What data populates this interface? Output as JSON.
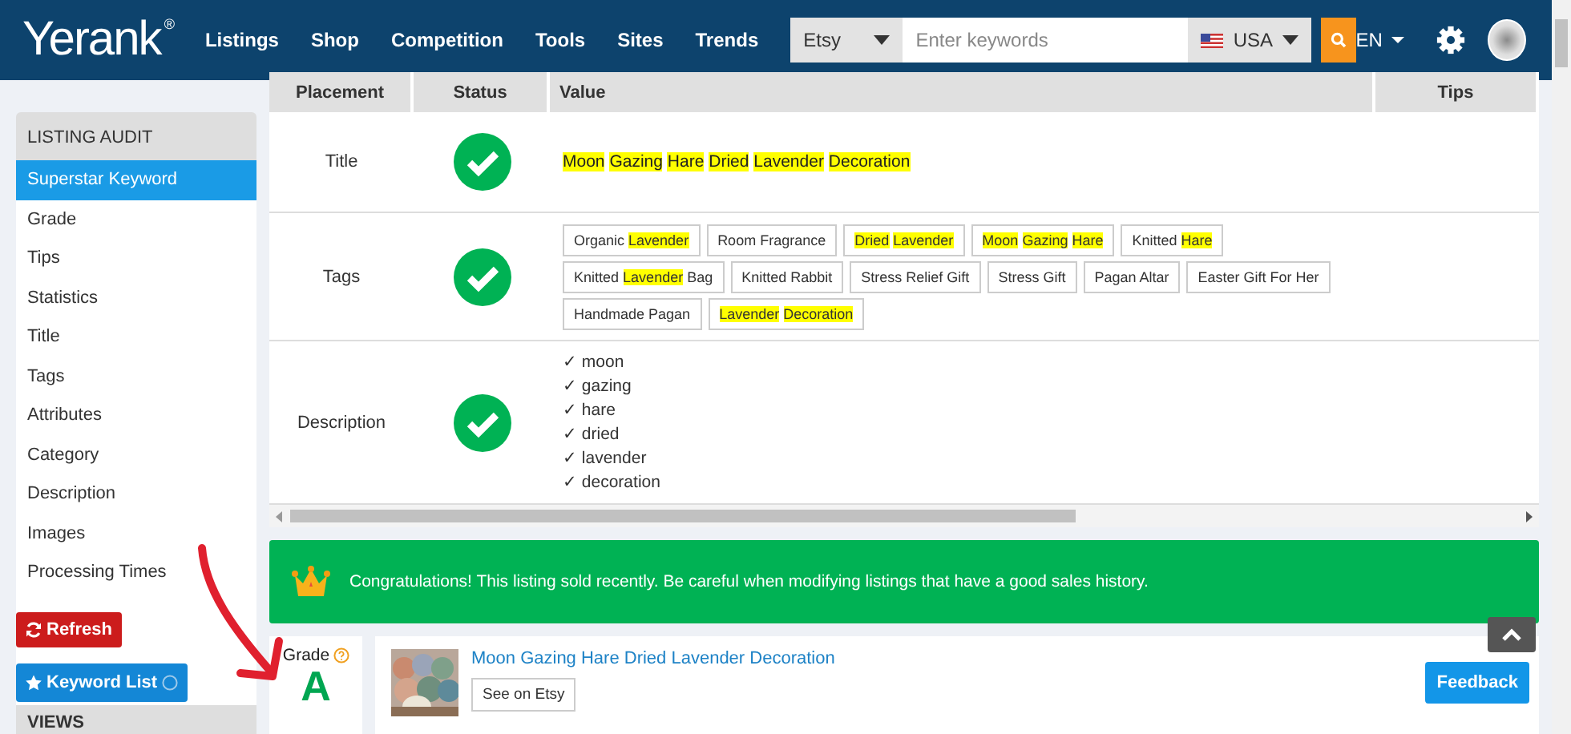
{
  "nav": {
    "logo": "Yerank",
    "logo_mark": "®",
    "links": [
      "Listings",
      "Shop",
      "Competition",
      "Tools",
      "Sites",
      "Trends"
    ],
    "platform": "Etsy",
    "search": {
      "placeholder": "Enter keywords"
    },
    "country": "USA",
    "language": "EN"
  },
  "sidebar": {
    "heading": "LISTING AUDIT",
    "items": [
      {
        "label": "Superstar Keyword",
        "selected": true
      },
      {
        "label": "Grade",
        "selected": false
      },
      {
        "label": "Tips",
        "selected": false
      },
      {
        "label": "Statistics",
        "selected": false
      },
      {
        "label": "Title",
        "selected": false
      },
      {
        "label": "Tags",
        "selected": false
      },
      {
        "label": "Attributes",
        "selected": false
      },
      {
        "label": "Category",
        "selected": false
      },
      {
        "label": "Description",
        "selected": false
      },
      {
        "label": "Images",
        "selected": false
      },
      {
        "label": "Processing Times",
        "selected": false
      }
    ],
    "next_heading": "VIEWS"
  },
  "floating_buttons": {
    "refresh": "Refresh",
    "keyword_list": "Keyword List"
  },
  "table": {
    "columns": [
      "Placement",
      "Status",
      "Value",
      "Tips"
    ],
    "rows": [
      {
        "kind": "title",
        "placement": "Title",
        "passed": true,
        "segments": [
          {
            "text": "Moon",
            "highlight": true
          },
          {
            "text": "Gazing",
            "highlight": true
          },
          {
            "text": "Hare",
            "highlight": true
          },
          {
            "text": "Dried",
            "highlight": true
          },
          {
            "text": "Lavender",
            "highlight": true
          },
          {
            "text": "Decoration",
            "highlight": true
          }
        ]
      },
      {
        "kind": "tags",
        "placement": "Tags",
        "passed": true,
        "tags": [
          [
            {
              "text": "Organic",
              "highlight": false
            },
            {
              "text": "Lavender",
              "highlight": true
            }
          ],
          [
            {
              "text": "Room Fragrance",
              "highlight": false
            }
          ],
          [
            {
              "text": "Dried",
              "highlight": true
            },
            {
              "text": "Lavender",
              "highlight": true
            }
          ],
          [
            {
              "text": "Moon",
              "highlight": true
            },
            {
              "text": "Gazing",
              "highlight": true
            },
            {
              "text": "Hare",
              "highlight": true
            }
          ],
          [
            {
              "text": "Knitted",
              "highlight": false
            },
            {
              "text": "Hare",
              "highlight": true
            }
          ],
          [
            {
              "text": "Knitted",
              "highlight": false
            },
            {
              "text": "Lavender",
              "highlight": true
            },
            {
              "text": "Bag",
              "highlight": false
            }
          ],
          [
            {
              "text": "Knitted Rabbit",
              "highlight": false
            }
          ],
          [
            {
              "text": "Stress Relief Gift",
              "highlight": false
            }
          ],
          [
            {
              "text": "Stress Gift",
              "highlight": false
            }
          ],
          [
            {
              "text": "Pagan Altar",
              "highlight": false
            }
          ],
          [
            {
              "text": "Easter Gift For Her",
              "highlight": false
            }
          ],
          [
            {
              "text": "Handmade Pagan",
              "highlight": false
            }
          ],
          [
            {
              "text": "Lavender",
              "highlight": true
            },
            {
              "text": "Decoration",
              "highlight": true
            }
          ]
        ]
      },
      {
        "kind": "words",
        "placement": "Description",
        "passed": true,
        "words": [
          "✓ moon",
          "✓ gazing",
          "✓ hare",
          "✓ dried",
          "✓ lavender",
          "✓ decoration"
        ]
      }
    ]
  },
  "alert": "Congratulations! This listing sold recently. Be careful when modifying listings that have a good sales history.",
  "grade": {
    "label": "Grade",
    "value": "A"
  },
  "listing": {
    "title": "Moon Gazing Hare Dried Lavender Decoration",
    "button": "See on Etsy",
    "feedback": "Feedback"
  }
}
